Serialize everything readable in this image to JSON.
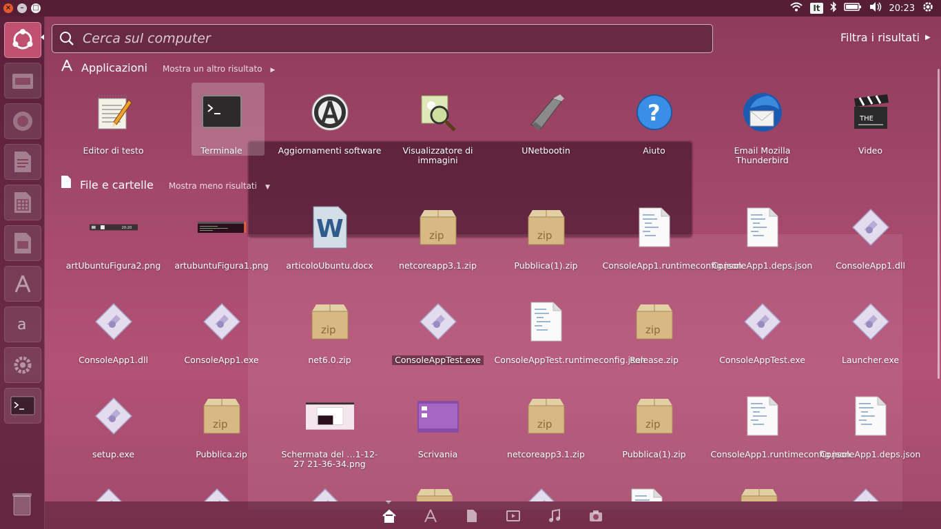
{
  "top_panel": {
    "window_controls": [
      "close",
      "minimize",
      "maximize"
    ],
    "keyboard_layout": "It",
    "clock": "20:23",
    "icons": [
      "wifi-icon",
      "bluetooth-icon",
      "battery-icon",
      "volume-icon",
      "settings-gear-icon"
    ]
  },
  "launcher": {
    "items": [
      {
        "name": "ubuntu-dash-icon"
      },
      {
        "name": "files-icon"
      },
      {
        "name": "firefox-icon"
      },
      {
        "name": "libreoffice-writer-icon"
      },
      {
        "name": "libreoffice-calc-icon"
      },
      {
        "name": "libreoffice-impress-icon"
      },
      {
        "name": "software-center-icon"
      },
      {
        "name": "amazon-icon"
      },
      {
        "name": "system-settings-icon"
      },
      {
        "name": "terminal-icon"
      },
      {
        "name": "trash-icon"
      }
    ]
  },
  "search": {
    "placeholder": "Cerca sul computer",
    "value": ""
  },
  "filter_label": "Filtra i risultati",
  "apps_section": {
    "title": "Applicazioni",
    "more_link": "Mostra un altro risultato",
    "items": [
      {
        "label": "Editor di testo",
        "icon": "text-editor-icon"
      },
      {
        "label": "Terminale",
        "icon": "terminal-icon",
        "selected": true
      },
      {
        "label": "Aggiornamenti software",
        "icon": "software-updater-icon"
      },
      {
        "label": "Visualizzatore di immagini",
        "icon": "image-viewer-icon"
      },
      {
        "label": "UNetbootin",
        "icon": "unetbootin-icon"
      },
      {
        "label": "Aiuto",
        "icon": "help-icon"
      },
      {
        "label": "Email Mozilla Thunderbird",
        "icon": "thunderbird-icon"
      },
      {
        "label": "Video",
        "icon": "video-clapper-icon"
      }
    ]
  },
  "files_section": {
    "title": "File e cartelle",
    "more_link": "Mostra meno risultati",
    "rows": [
      [
        {
          "label": "artUbuntuFigura2.png",
          "icon": "png-thumbnail-panel-icon"
        },
        {
          "label": "artubuntuFigura1.png",
          "icon": "png-thumbnail-terminal-icon"
        },
        {
          "label": "articoloUbuntu.docx",
          "icon": "word-document-icon"
        },
        {
          "label": "netcoreapp3.1.zip",
          "icon": "zip-archive-icon"
        },
        {
          "label": "Pubblica(1).zip",
          "icon": "zip-archive-icon"
        },
        {
          "label": "ConsoleApp1.runtimeconfig.json",
          "icon": "json-file-icon"
        },
        {
          "label": "ConsoleApp1.deps.json",
          "icon": "json-file-icon"
        },
        {
          "label": "ConsoleApp1.dll",
          "icon": "executable-file-icon"
        }
      ],
      [
        {
          "label": "ConsoleApp1.dll",
          "icon": "executable-file-icon"
        },
        {
          "label": "ConsoleApp1.exe",
          "icon": "executable-file-icon"
        },
        {
          "label": "net6.0.zip",
          "icon": "zip-archive-icon"
        },
        {
          "label": "ConsoleAppTest.exe",
          "icon": "executable-file-icon"
        },
        {
          "label": "ConsoleAppTest.runtimeconfig.json",
          "icon": "json-file-icon"
        },
        {
          "label": "Release.zip",
          "icon": "zip-archive-icon"
        },
        {
          "label": "ConsoleAppTest.exe",
          "icon": "executable-file-icon"
        },
        {
          "label": "Launcher.exe",
          "icon": "executable-file-icon"
        }
      ],
      [
        {
          "label": "setup.exe",
          "icon": "executable-file-icon"
        },
        {
          "label": "Pubblica.zip",
          "icon": "zip-archive-icon"
        },
        {
          "label": "Schermata del …1-12-27 21-36-34.png",
          "icon": "screenshot-thumbnail-icon"
        },
        {
          "label": "Scrivania",
          "icon": "desktop-folder-icon"
        },
        {
          "label": "netcoreapp3.1.zip",
          "icon": "zip-archive-icon"
        },
        {
          "label": "Pubblica(1).zip",
          "icon": "zip-archive-icon"
        },
        {
          "label": "ConsoleApp1.runtimeconfig.json",
          "icon": "json-file-icon"
        },
        {
          "label": "ConsoleApp1.deps.json",
          "icon": "json-file-icon"
        }
      ]
    ]
  },
  "lens_bar": {
    "lenses": [
      "home-lens-icon",
      "applications-lens-icon",
      "files-lens-icon",
      "video-lens-icon",
      "music-lens-icon",
      "photo-lens-icon"
    ],
    "active": "home-lens-icon"
  }
}
